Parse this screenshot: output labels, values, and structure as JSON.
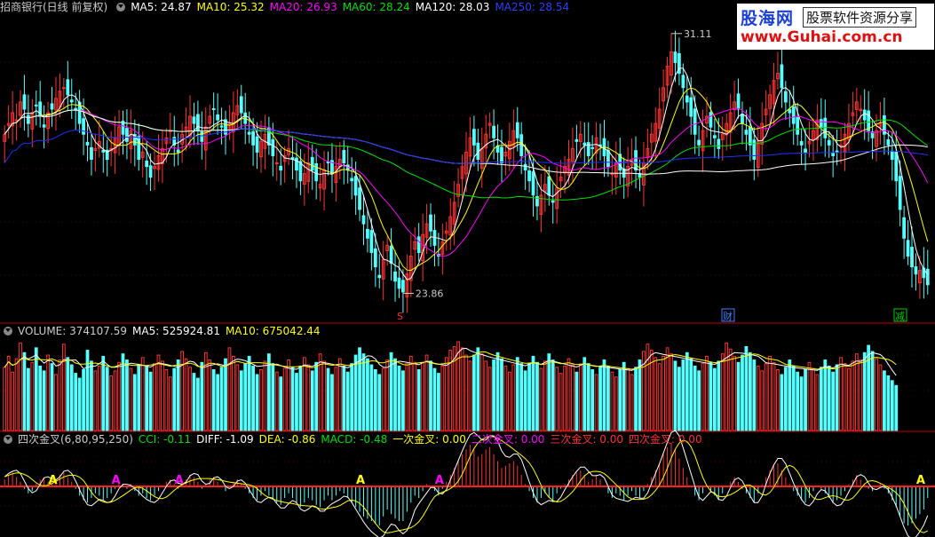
{
  "price_header": {
    "title": "招商银行(日线 前复权)",
    "ma5": "MA5: 24.87",
    "ma10": "MA10: 25.32",
    "ma20": "MA20: 26.93",
    "ma60": "MA60: 28.24",
    "ma120": "MA120: 28.03",
    "ma250": "MA250: 28.54"
  },
  "volume_header": {
    "volume": "VOLUME: 374107.59",
    "ma5": "MA5: 525924.81",
    "ma10": "MA10: 675042.44"
  },
  "indicator_header": {
    "name": "四次金叉(6,80,95,250)",
    "cci": "CCI: -0.11",
    "diff": "DIFF: -1.09",
    "dea": "DEA: -0.86",
    "macd": "MACD: -0.48",
    "cross1": "一次金叉: 0.00",
    "cross2": "二次金叉: 0.00",
    "cross3": "三次金叉: 0.00",
    "cross4": "四次金叉: 0.00"
  },
  "annotations": {
    "high": "31.11",
    "low": "23.86",
    "marker_s": "S",
    "marker_cai": "财",
    "marker_jian": "减"
  },
  "watermark": {
    "line1": "股海网",
    "line2": "股票软件资源分享",
    "line3": "www.Guhai.com.cn"
  },
  "colors": {
    "up": "#ff3232",
    "down": "#54ffff",
    "ma5": "#ffffff",
    "ma10": "#ffff00",
    "ma20": "#ff00ff",
    "ma60": "#00e000",
    "ma120": "#ffffff",
    "ma250": "#2030ff",
    "divider": "#c00000"
  },
  "chart_data": [
    {
      "type": "candlestick",
      "panel": "price",
      "high_label": 31.11,
      "low_label": 23.86,
      "ylim": [
        23.5,
        31.6
      ],
      "closes": [
        28.3,
        28.6,
        28.9,
        28.7,
        29.2,
        29.0,
        28.6,
        28.9,
        29.1,
        28.8,
        28.5,
        28.9,
        29.0,
        29.3,
        29.5,
        29.6,
        29.4,
        29.2,
        29.0,
        28.6,
        28.3,
        28.0,
        27.6,
        27.9,
        28.1,
        27.8,
        27.6,
        27.9,
        28.2,
        28.5,
        28.3,
        28.1,
        28.4,
        28.0,
        27.6,
        27.8,
        27.4,
        27.1,
        27.4,
        27.7,
        27.9,
        28.2,
        28.4,
        28.0,
        27.8,
        28.3,
        28.5,
        28.8,
        28.6,
        28.4,
        28.1,
        28.5,
        28.8,
        29.0,
        28.7,
        28.5,
        28.3,
        28.6,
        28.9,
        29.1,
        28.9,
        28.6,
        28.3,
        28.0,
        27.8,
        28.1,
        28.3,
        28.0,
        27.7,
        27.5,
        27.3,
        27.7,
        27.9,
        27.6,
        27.3,
        27.0,
        27.2,
        27.5,
        27.3,
        27.0,
        26.9,
        27.3,
        27.5,
        27.2,
        27.4,
        27.6,
        27.5,
        27.3,
        27.0,
        26.6,
        26.2,
        25.8,
        25.4,
        25.0,
        24.6,
        24.3,
        24.8,
        25.2,
        24.7,
        24.2,
        24.0,
        23.9,
        24.4,
        24.9,
        25.3,
        25.0,
        25.5,
        25.8,
        25.6,
        25.2,
        24.9,
        25.3,
        25.6,
        26.0,
        26.4,
        26.9,
        27.4,
        27.8,
        28.2,
        28.0,
        27.6,
        27.9,
        28.3,
        28.6,
        28.2,
        27.8,
        27.5,
        27.8,
        28.1,
        28.4,
        28.2,
        27.7,
        27.3,
        27.0,
        26.6,
        26.3,
        26.6,
        26.9,
        26.6,
        26.4,
        26.8,
        27.1,
        27.4,
        27.6,
        27.9,
        28.1,
        28.3,
        28.0,
        27.7,
        27.9,
        28.2,
        28.0,
        27.7,
        27.4,
        27.2,
        27.5,
        27.3,
        27.1,
        27.4,
        27.6,
        27.3,
        27.1,
        27.5,
        27.9,
        28.3,
        28.6,
        29.0,
        29.6,
        30.2,
        30.6,
        30.3,
        30.0,
        29.6,
        29.2,
        28.8,
        28.3,
        28.0,
        28.4,
        28.8,
        28.5,
        28.2,
        27.9,
        28.3,
        28.6,
        28.9,
        29.2,
        29.0,
        28.6,
        28.3,
        28.0,
        27.6,
        28.1,
        28.6,
        29.0,
        29.4,
        29.8,
        30.0,
        29.6,
        29.2,
        28.9,
        28.6,
        28.3,
        28.0,
        27.8,
        28.1,
        28.4,
        28.7,
        28.5,
        28.2,
        28.0,
        27.7,
        27.8,
        28.0,
        28.3,
        28.6,
        28.9,
        29.2,
        29.0,
        28.7,
        28.4,
        28.2,
        28.4,
        28.6,
        28.3,
        28.0,
        27.6,
        27.0,
        26.2,
        25.4,
        24.9,
        24.6,
        24.4,
        24.5,
        24.3,
        24.1
      ]
    },
    {
      "type": "bar",
      "panel": "volume",
      "values": [
        5.2,
        6.1,
        4.8,
        5.9,
        7.2,
        6.4,
        5.1,
        5.6,
        6.8,
        5.3,
        4.9,
        6.2,
        5.5,
        4.6,
        5.8,
        7.1,
        6.0,
        5.4,
        4.7,
        4.3,
        5.0,
        6.6,
        5.7,
        4.9,
        5.3,
        6.1,
        5.2,
        4.5,
        4.9,
        5.6,
        6.3,
        5.8,
        5.1,
        4.6,
        5.4,
        6.0,
        5.3,
        4.8,
        5.5,
        6.2,
        5.7,
        5.0,
        4.4,
        5.1,
        5.8,
        6.5,
        5.9,
        5.2,
        4.7,
        4.3,
        5.6,
        6.4,
        5.8,
        5.0,
        4.6,
        5.2,
        5.9,
        6.8,
        6.1,
        5.4,
        4.9,
        5.5,
        6.1,
        5.3,
        4.6,
        5.0,
        5.7,
        6.3,
        5.5,
        4.8,
        4.4,
        5.1,
        5.8,
        5.2,
        4.7,
        5.3,
        6.0,
        5.4,
        4.9,
        5.6,
        6.3,
        5.7,
        5.1,
        4.6,
        5.2,
        5.9,
        5.3,
        4.8,
        5.5,
        6.2,
        6.8,
        6.3,
        5.9,
        5.4,
        5.0,
        4.6,
        5.1,
        5.8,
        6.4,
        5.9,
        5.3,
        4.9,
        5.5,
        6.1,
        5.6,
        5.0,
        5.6,
        6.2,
        5.7,
        5.1,
        4.7,
        5.3,
        6.0,
        6.6,
        6.9,
        7.3,
        6.8,
        6.2,
        5.7,
        6.2,
        6.8,
        6.3,
        5.7,
        5.2,
        5.8,
        6.4,
        5.9,
        5.3,
        4.8,
        5.4,
        6.0,
        5.5,
        4.9,
        5.5,
        6.1,
        5.6,
        5.1,
        5.7,
        6.3,
        5.8,
        5.2,
        4.7,
        5.3,
        5.9,
        5.4,
        4.8,
        5.4,
        6.0,
        5.5,
        5.0,
        4.6,
        5.2,
        5.8,
        5.3,
        4.8,
        4.4,
        5.0,
        5.6,
        5.1,
        4.6,
        5.2,
        5.8,
        6.5,
        7.1,
        6.6,
        6.0,
        5.5,
        6.1,
        6.8,
        6.3,
        5.7,
        5.2,
        5.8,
        6.4,
        5.9,
        5.3,
        4.9,
        5.5,
        6.1,
        5.6,
        5.1,
        5.7,
        6.3,
        7.2,
        6.7,
        6.1,
        5.6,
        6.2,
        6.9,
        6.4,
        5.8,
        5.3,
        4.9,
        5.5,
        6.1,
        5.6,
        5.0,
        4.6,
        5.2,
        5.8,
        5.3,
        4.8,
        4.4,
        5.0,
        5.6,
        5.1,
        4.6,
        5.2,
        5.8,
        5.3,
        4.8,
        5.4,
        6.0,
        5.5,
        5.1,
        5.7,
        6.3,
        5.8,
        6.4,
        7.0,
        6.5,
        5.9,
        5.4,
        4.9,
        4.5,
        4.1,
        3.7
      ],
      "ma5_last": 525924.81,
      "ma10_last": 675042.44,
      "volume_last": 374107.59
    },
    {
      "type": "bar",
      "panel": "macd",
      "values": [
        0.3,
        0.5,
        0.6,
        0.4,
        0.2,
        -0.1,
        -0.3,
        -0.2,
        0.1,
        0.3,
        0.4,
        0.2,
        0.1,
        0.3,
        0.5,
        0.6,
        0.4,
        0.2,
        -0.1,
        -0.4,
        -0.6,
        -0.7,
        -0.5,
        -0.3,
        -0.4,
        -0.6,
        -0.5,
        -0.3,
        -0.1,
        0.2,
        0.1,
        -0.1,
        0.1,
        -0.2,
        -0.4,
        -0.3,
        -0.5,
        -0.6,
        -0.4,
        -0.2,
        0.0,
        0.2,
        0.3,
        0.1,
        -0.1,
        0.2,
        0.3,
        0.5,
        0.4,
        0.2,
        -0.1,
        0.1,
        0.3,
        0.4,
        0.2,
        0.0,
        -0.2,
        0.0,
        0.2,
        0.3,
        0.1,
        -0.1,
        -0.3,
        -0.5,
        -0.6,
        -0.4,
        -0.2,
        -0.4,
        -0.5,
        -0.7,
        -0.8,
        -0.5,
        -0.3,
        -0.5,
        -0.7,
        -0.9,
        -0.7,
        -0.5,
        -0.6,
        -0.8,
        -0.9,
        -0.6,
        -0.4,
        -0.6,
        -0.4,
        -0.2,
        -0.3,
        -0.5,
        -0.7,
        -0.9,
        -1.1,
        -1.3,
        -1.4,
        -1.5,
        -1.6,
        -1.7,
        -1.3,
        -1.0,
        -1.2,
        -1.4,
        -1.5,
        -1.5,
        -1.1,
        -0.7,
        -0.4,
        -0.5,
        -0.2,
        0.1,
        0.0,
        -0.2,
        -0.4,
        -0.1,
        0.2,
        0.5,
        0.8,
        1.1,
        1.4,
        1.6,
        1.8,
        1.6,
        1.3,
        1.4,
        1.6,
        1.7,
        1.4,
        1.1,
        0.8,
        0.9,
        1.0,
        1.1,
        0.9,
        0.5,
        0.1,
        -0.2,
        -0.5,
        -0.7,
        -0.5,
        -0.3,
        -0.5,
        -0.6,
        -0.3,
        -0.1,
        0.1,
        0.3,
        0.5,
        0.6,
        0.7,
        0.5,
        0.2,
        0.3,
        0.5,
        0.3,
        0.0,
        -0.3,
        -0.5,
        -0.3,
        -0.4,
        -0.6,
        -0.4,
        -0.2,
        -0.4,
        -0.5,
        -0.2,
        0.1,
        0.4,
        0.7,
        1.0,
        1.4,
        1.7,
        1.9,
        1.6,
        1.2,
        0.8,
        0.4,
        0.0,
        -0.4,
        -0.6,
        -0.3,
        0.0,
        -0.2,
        -0.4,
        -0.6,
        -0.3,
        0.0,
        0.2,
        0.4,
        0.2,
        -0.1,
        -0.3,
        -0.5,
        -0.7,
        -0.3,
        0.1,
        0.4,
        0.7,
        0.9,
        1.0,
        0.7,
        0.4,
        0.1,
        -0.2,
        -0.4,
        -0.6,
        -0.7,
        -0.5,
        -0.2,
        0.0,
        -0.1,
        -0.3,
        -0.5,
        -0.7,
        -0.6,
        -0.4,
        -0.2,
        0.1,
        0.3,
        0.5,
        0.3,
        0.1,
        -0.1,
        -0.2,
        0.0,
        0.1,
        -0.1,
        -0.3,
        -0.6,
        -0.9,
        -1.3,
        -1.6,
        -1.7,
        -1.6,
        -1.4,
        -1.2,
        -1.0,
        -0.5
      ],
      "golden_cross_markers": [
        12,
        28,
        44,
        90,
        110,
        232,
        244
      ]
    }
  ]
}
